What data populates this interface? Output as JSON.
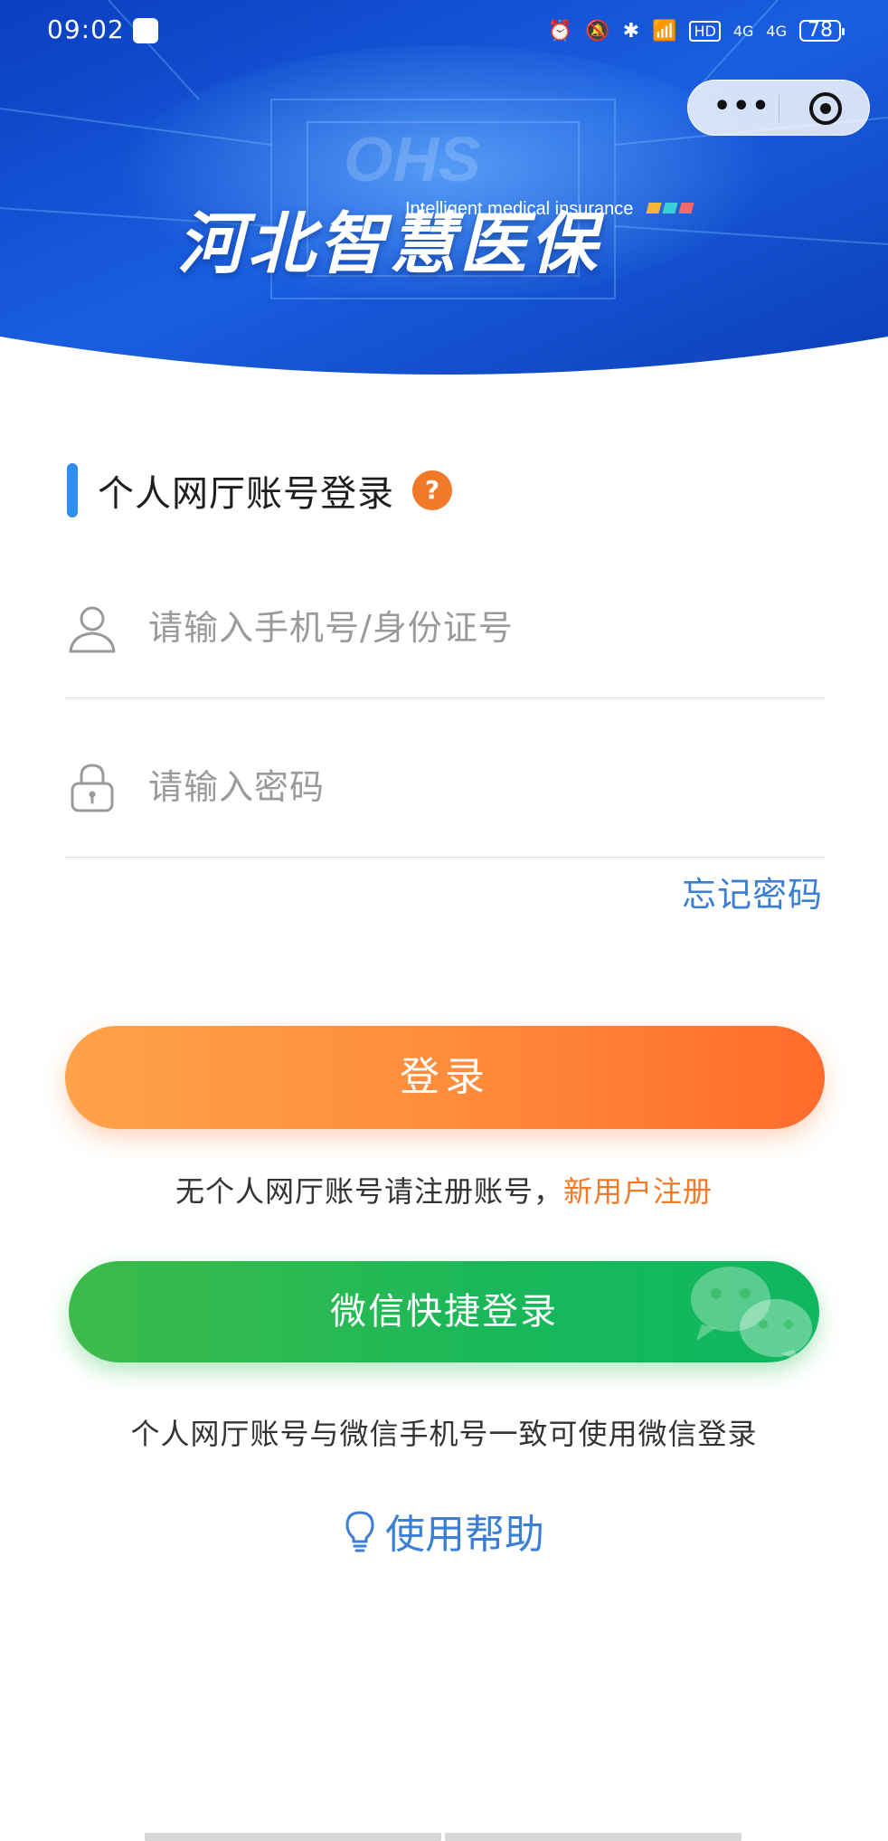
{
  "status_bar": {
    "time": "09:02",
    "signal_1": "4G",
    "signal_2": "4G",
    "battery": "78"
  },
  "capsule": {
    "more": "•••"
  },
  "banner": {
    "title_cn": "河北智慧医保",
    "subtitle_en": "Intelligent medical insurance"
  },
  "login": {
    "section_title": "个人网厅账号登录",
    "help_badge": "?",
    "username_placeholder": "请输入手机号/身份证号",
    "password_placeholder": "请输入密码",
    "forgot_password": "忘记密码",
    "login_button": "登录",
    "register_prompt": "无个人网厅账号请注册账号，",
    "register_link": "新用户注册",
    "wechat_button": "微信快捷登录",
    "wechat_note": "个人网厅账号与微信手机号一致可使用微信登录",
    "help_link": "使用帮助"
  },
  "colors": {
    "accent_blue": "#3b7fd4",
    "login_orange": "#ff8a3a",
    "wechat_green": "#18b85a",
    "banner_blue": "#1553d6"
  },
  "icons": [
    "user-icon",
    "lock-icon",
    "wechat-icon",
    "bulb-icon",
    "more-icon",
    "target-icon"
  ]
}
